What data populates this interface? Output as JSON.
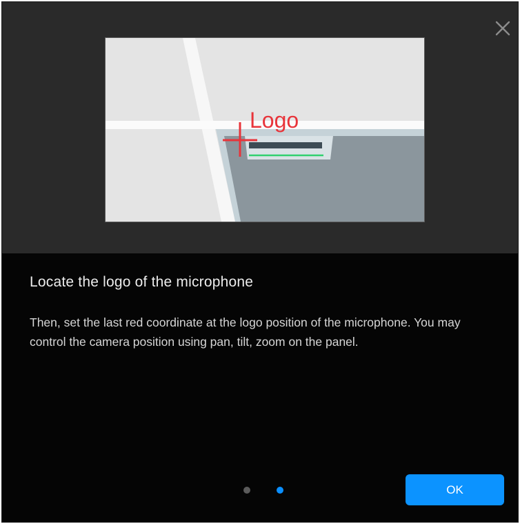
{
  "dialog": {
    "close_icon": "close-icon",
    "illustration": {
      "label": "Logo",
      "crosshair_color": "#e8343a",
      "underline_color": "#2fd06f"
    },
    "title": "Locate the logo of the microphone",
    "description": "Then, set the last red coordinate at the logo position of the microphone. You may control the camera position using pan, tilt, zoom on the panel.",
    "pager": {
      "total_pages": 2,
      "current_page": 2
    },
    "ok_label": "OK",
    "accent_color": "#0c93ff"
  }
}
